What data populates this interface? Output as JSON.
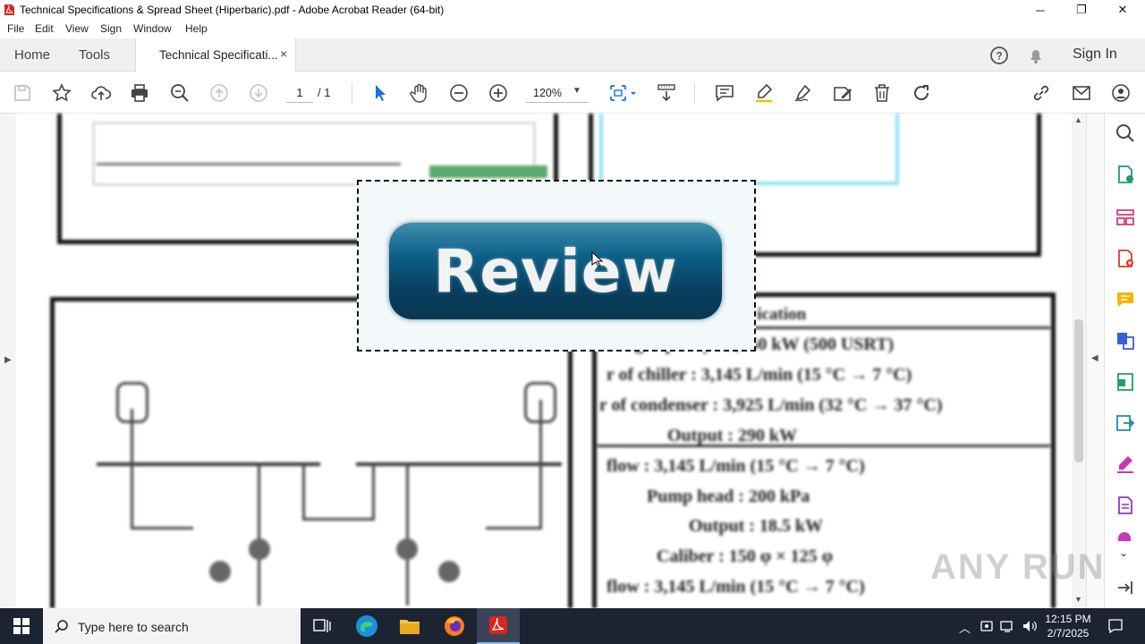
{
  "window": {
    "title": "Technical Specifications & Spread Sheet (Hiperbaric).pdf - Adobe Acrobat Reader (64-bit)",
    "minimize": "─",
    "maximize": "❐",
    "close": "✕"
  },
  "menu": [
    "File",
    "Edit",
    "View",
    "Sign",
    "Window",
    "Help"
  ],
  "tabs": {
    "home": "Home",
    "tools": "Tools",
    "document": "Technical Specificati...",
    "close": "×",
    "help_icon": "help-icon",
    "sign_in": "Sign In"
  },
  "toolbar": {
    "page_current": "1",
    "page_total": "/ 1",
    "zoom": "120%"
  },
  "popup": {
    "button_label": "Review"
  },
  "document_text": [
    "·ication",
    "ing capacity : 1,750 kW (500 USRT)",
    "r of chiller : 3,145 L/min (15 °C → 7 °C)",
    "r of condenser : 3,925 L/min (32 °C → 37 °C)",
    "Output : 290 kW",
    "flow : 3,145 L/min (15 °C → 7 °C)",
    "Pump head : 200 kPa",
    "Output : 18.5 kW",
    "Caliber : 150 φ × 125 φ",
    "flow : 3,145 L/min (15 °C → 7 °C)"
  ],
  "watermark": "ANY RUN",
  "taskbar": {
    "search_placeholder": "Type here to search",
    "time": "12:15 PM",
    "date": "2/7/2025"
  },
  "colors": {
    "accent": "#1473e6",
    "taskbar": "#1c2433",
    "review_button": "#0d5f87"
  }
}
